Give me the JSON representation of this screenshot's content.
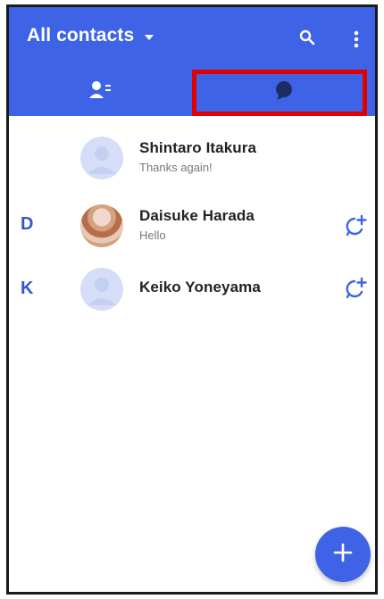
{
  "header": {
    "title": "All contacts",
    "icons": [
      "search-icon",
      "more-vert-icon"
    ]
  },
  "tabs": [
    {
      "icon": "contacts-icon",
      "selected": true
    },
    {
      "icon": "chat-bubble-icon",
      "selected": false
    }
  ],
  "contacts": [
    {
      "letter": "",
      "name": "Shintaro Itakura",
      "message": "Thanks again!",
      "avatar": "default-avatar",
      "action": ""
    },
    {
      "letter": "D",
      "name": "Daisuke Harada",
      "message": "Hello",
      "avatar": "photo-avatar",
      "action": "new-chat-icon"
    },
    {
      "letter": "K",
      "name": "Keiko Yoneyama",
      "message": "",
      "avatar": "default-avatar",
      "action": "new-chat-icon"
    }
  ],
  "fab": {
    "icon": "add-icon"
  },
  "colors": {
    "accent": "#3f63e6",
    "highlight": "#e00000",
    "letter": "#3356d8",
    "avatar_placeholder": "#d6def7"
  }
}
